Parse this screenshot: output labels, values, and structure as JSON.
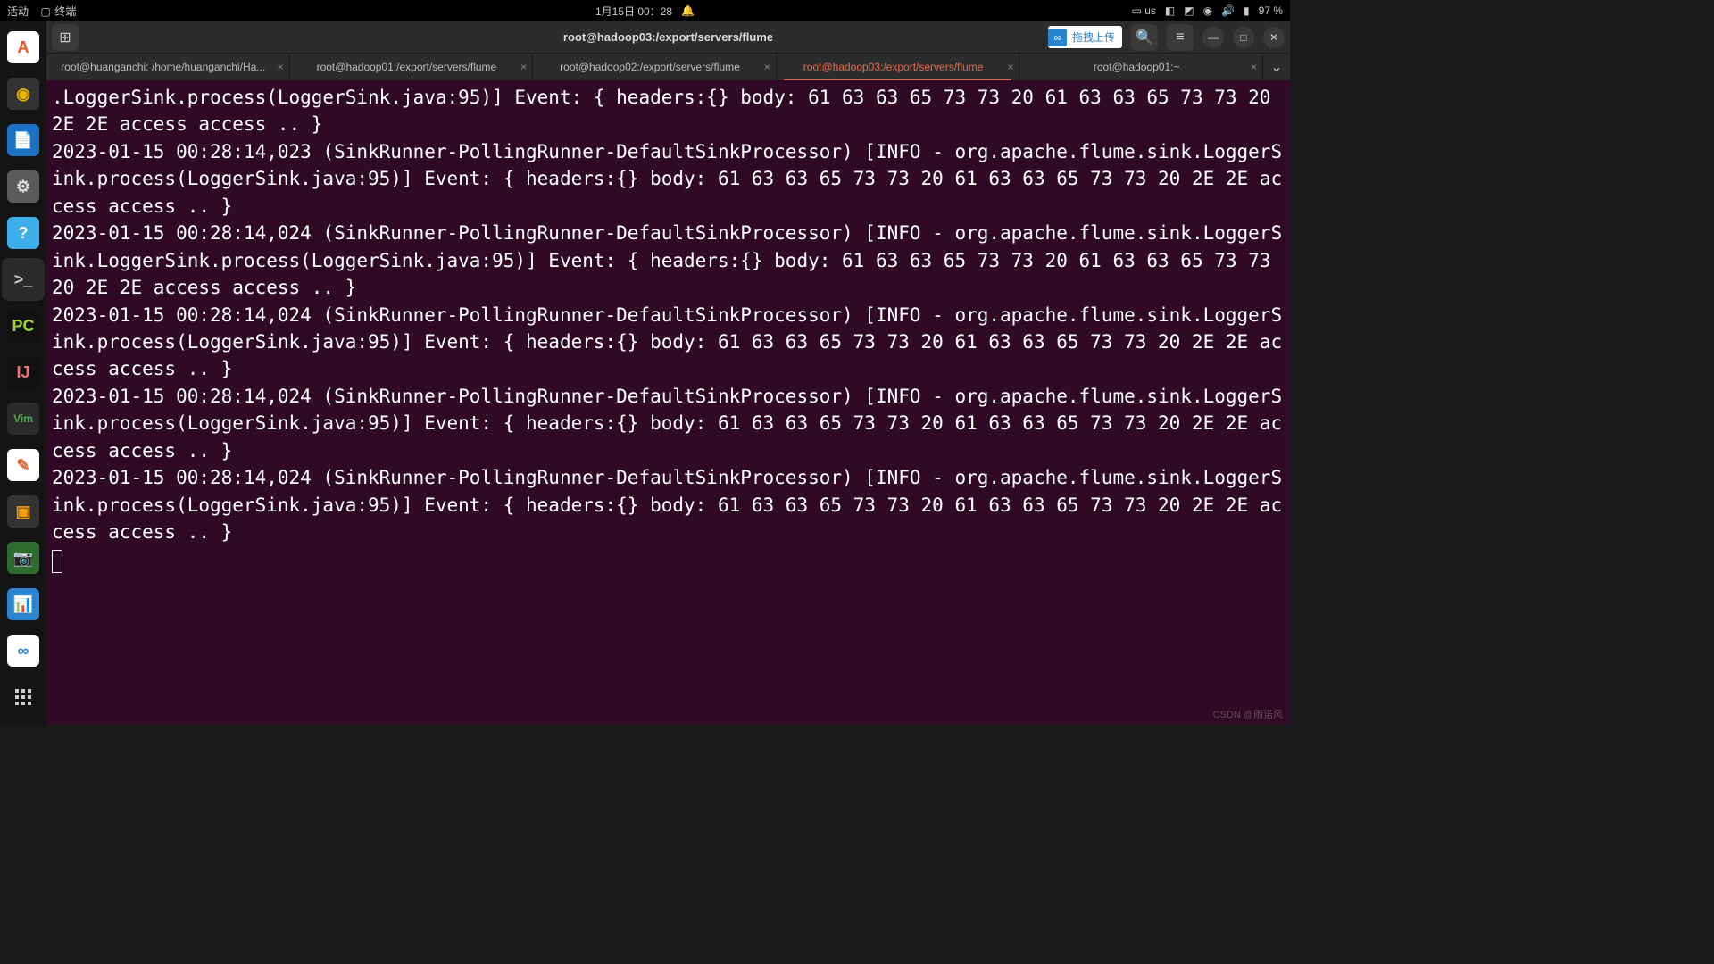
{
  "topbar": {
    "activities": "活动",
    "app_name": "终端",
    "datetime": "1月15日 00：28",
    "input_lang": "us",
    "battery": "97 %"
  },
  "dock": [
    {
      "name": "software",
      "bg": "#fff",
      "label": "A",
      "fg": "#e95420"
    },
    {
      "name": "music",
      "bg": "#333",
      "label": "◉",
      "fg": "#e6b400"
    },
    {
      "name": "writer",
      "bg": "#1a73c7",
      "label": "📄",
      "fg": "#fff"
    },
    {
      "name": "settings",
      "bg": "#5b5b5b",
      "label": "⚙",
      "fg": "#ddd"
    },
    {
      "name": "help",
      "bg": "#3daee9",
      "label": "?",
      "fg": "#fff"
    },
    {
      "name": "terminal",
      "bg": "#2b2b2b",
      "label": ">_",
      "fg": "#ccc",
      "active": true
    },
    {
      "name": "pycharm",
      "bg": "#111",
      "label": "PC",
      "fg": "#9fd434"
    },
    {
      "name": "idea",
      "bg": "#111",
      "label": "IJ",
      "fg": "#f0707a"
    },
    {
      "name": "vim",
      "bg": "#2b2b2b",
      "label": "Vim",
      "fg": "#4caf50"
    },
    {
      "name": "gedit",
      "bg": "#fff",
      "label": "✎",
      "fg": "#d9643a"
    },
    {
      "name": "vbox",
      "bg": "#333",
      "label": "▣",
      "fg": "#f39c12"
    },
    {
      "name": "screenshot",
      "bg": "#2e6b2e",
      "label": "📷",
      "fg": "#fff"
    },
    {
      "name": "meeting",
      "bg": "#2a85d0",
      "label": "📊",
      "fg": "#fff"
    },
    {
      "name": "cloud",
      "bg": "#fff",
      "label": "∞",
      "fg": "#2a85d0"
    },
    {
      "name": "apps",
      "bg": "transparent",
      "label": "",
      "fg": "#ccc",
      "apps": true
    }
  ],
  "window": {
    "title": "root@hadoop03:/export/servers/flume",
    "upload_text": "拖拽上传"
  },
  "tabs": [
    {
      "label": "root@huanganchi: /home/huanganchi/Ha..."
    },
    {
      "label": "root@hadoop01:/export/servers/flume"
    },
    {
      "label": "root@hadoop02:/export/servers/flume"
    },
    {
      "label": "root@hadoop03:/export/servers/flume",
      "active": true
    },
    {
      "label": "root@hadoop01:~"
    }
  ],
  "terminal_lines": [
    ".LoggerSink.process(LoggerSink.java:95)] Event: { headers:{} body: 61 63 63 65 73 73 20 61 63 63 65 73 73 20 2E 2E access access .. }",
    "2023-01-15 00:28:14,023 (SinkRunner-PollingRunner-DefaultSinkProcessor) [INFO - org.apache.flume.sink.LoggerSink.process(LoggerSink.java:95)] Event: { headers:{} body: 61 63 63 65 73 73 20 61 63 63 65 73 73 20 2E 2E access access .. }",
    "2023-01-15 00:28:14,024 (SinkRunner-PollingRunner-DefaultSinkProcessor) [INFO - org.apache.flume.sink.LoggerSink.LoggerSink.process(LoggerSink.java:95)] Event: { headers:{} body: 61 63 63 65 73 73 20 61 63 63 65 73 73 20 2E 2E access access .. }",
    "2023-01-15 00:28:14,024 (SinkRunner-PollingRunner-DefaultSinkProcessor) [INFO - org.apache.flume.sink.LoggerSink.process(LoggerSink.java:95)] Event: { headers:{} body: 61 63 63 65 73 73 20 61 63 63 65 73 73 20 2E 2E access access .. }",
    "2023-01-15 00:28:14,024 (SinkRunner-PollingRunner-DefaultSinkProcessor) [INFO - org.apache.flume.sink.LoggerSink.process(LoggerSink.java:95)] Event: { headers:{} body: 61 63 63 65 73 73 20 61 63 63 65 73 73 20 2E 2E access access .. }",
    "2023-01-15 00:28:14,024 (SinkRunner-PollingRunner-DefaultSinkProcessor) [INFO - org.apache.flume.sink.LoggerSink.process(LoggerSink.java:95)] Event: { headers:{} body: 61 63 63 65 73 73 20 61 63 63 65 73 73 20 2E 2E access access .. }"
  ],
  "watermark": "CSDN @雨诺风"
}
